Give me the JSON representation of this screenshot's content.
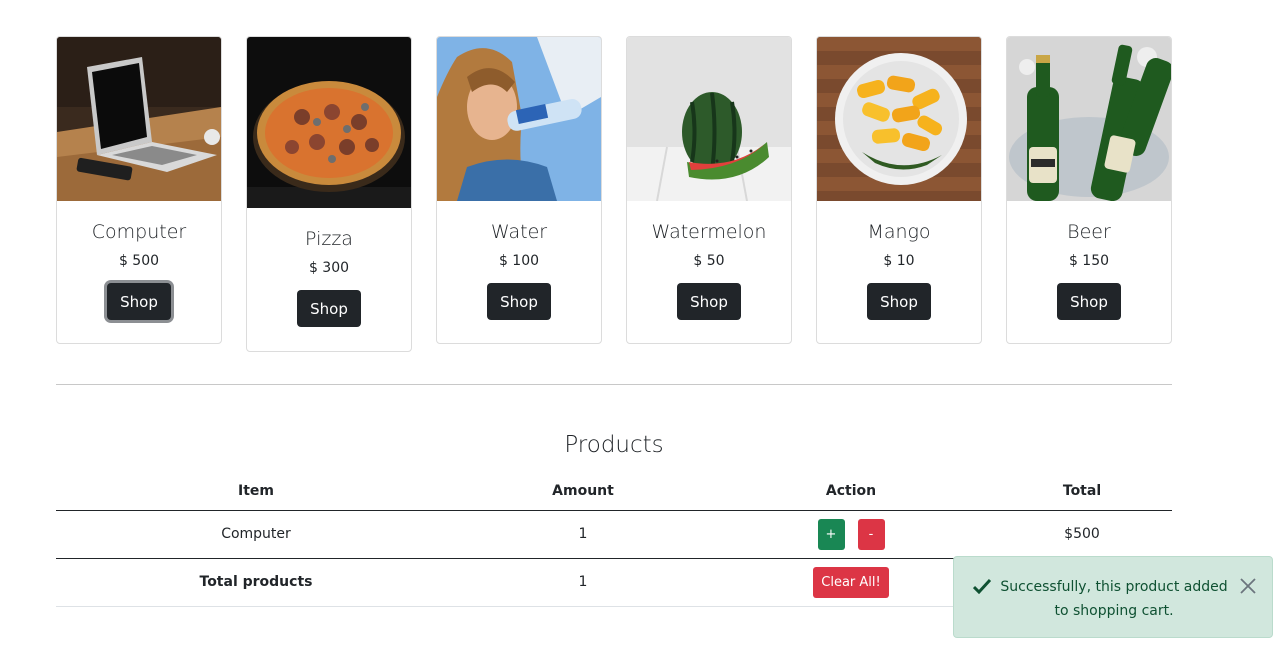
{
  "products": [
    {
      "name": "Computer",
      "price": "$ 500",
      "shop_label": "Shop",
      "image": "laptop-photo"
    },
    {
      "name": "Pizza",
      "price": "$ 300",
      "shop_label": "Shop",
      "image": "pizza-photo"
    },
    {
      "name": "Water",
      "price": "$ 100",
      "shop_label": "Shop",
      "image": "woman-drinking-water-photo"
    },
    {
      "name": "Watermelon",
      "price": "$ 50",
      "shop_label": "Shop",
      "image": "watermelon-photo"
    },
    {
      "name": "Mango",
      "price": "$ 10",
      "shop_label": "Shop",
      "image": "mango-plate-photo"
    },
    {
      "name": "Beer",
      "price": "$ 150",
      "shop_label": "Shop",
      "image": "beer-bottles-photo"
    }
  ],
  "cart": {
    "title": "Products",
    "headers": [
      "Item",
      "Amount",
      "Action",
      "Total"
    ],
    "rows": [
      {
        "item": "Computer",
        "amount": "1",
        "plus_label": "+",
        "minus_label": "-",
        "total": "$500"
      }
    ],
    "summary": {
      "label": "Total products",
      "amount": "1",
      "clear_label": "Clear All!"
    }
  },
  "toast": {
    "message": "Successfully, this product added to shopping cart.",
    "icon": "check-icon",
    "close_icon": "close-icon"
  },
  "colors": {
    "button_dark": "#212529",
    "success": "#198754",
    "danger": "#dc3545",
    "toast_bg": "#d1e7dd",
    "toast_text": "#0f5132"
  }
}
